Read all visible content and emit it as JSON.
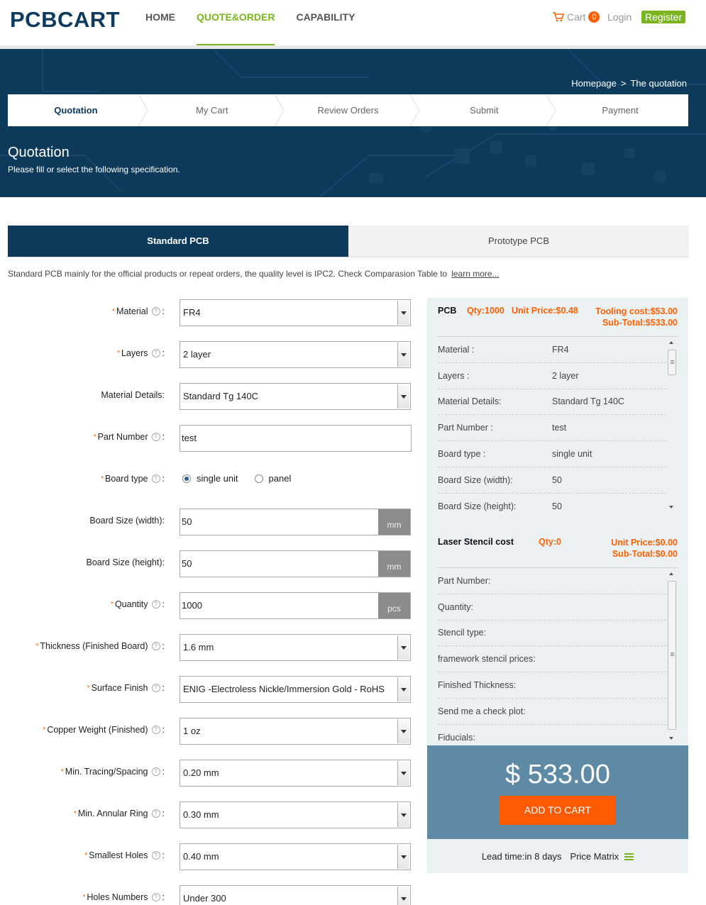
{
  "header": {
    "logo": "PCBCART",
    "nav": [
      "HOME",
      "QUOTE&ORDER",
      "CAPABILITY"
    ],
    "active_nav": "QUOTE&ORDER",
    "cart_label": "Cart",
    "cart_count": "0",
    "login": "Login",
    "register": "Register"
  },
  "banner": {
    "breadcrumb": [
      "Homepage",
      ">",
      "The quotation"
    ],
    "steps": [
      "Quotation",
      "My Cart",
      "Review Orders",
      "Submit",
      "Payment"
    ],
    "title": "Quotation",
    "subtitle": "Please fill or select the following specification."
  },
  "tabs": [
    "Standard PCB",
    "Prototype PCB"
  ],
  "description": {
    "text": "Standard PCB mainly for the official products or repeat orders, the quality level is IPC2. Check Comparasion Table to",
    "link": "learn more..."
  },
  "form": {
    "material": {
      "label": "Material",
      "value": "FR4"
    },
    "layers": {
      "label": "Layers",
      "value": "2 layer"
    },
    "material_details": {
      "label": "Material Details:",
      "value": "Standard Tg 140C"
    },
    "part_number": {
      "label": "Part Number",
      "value": "test"
    },
    "board_type": {
      "label": "Board type",
      "options": [
        "single unit",
        "panel"
      ],
      "selected": "single unit"
    },
    "board_width": {
      "label": "Board Size (width):",
      "value": "50",
      "unit": "mm"
    },
    "board_height": {
      "label": "Board Size (height):",
      "value": "50",
      "unit": "mm"
    },
    "quantity": {
      "label": "Quantity",
      "value": "1000",
      "unit": "pcs"
    },
    "thickness": {
      "label": "Thickness (Finished Board)",
      "value": "1.6 mm"
    },
    "surface_finish": {
      "label": "Surface Finish",
      "value": "ENIG -Electroless Nickle/Immersion Gold - RoHS"
    },
    "copper_weight": {
      "label": "Copper Weight (Finished)",
      "value": "1 oz"
    },
    "min_tracing": {
      "label": "Min. Tracing/Spacing",
      "value": "0.20 mm"
    },
    "min_annular": {
      "label": "Min. Annular Ring",
      "value": "0.30 mm"
    },
    "smallest_holes": {
      "label": "Smallest Holes",
      "value": "0.40 mm"
    },
    "holes_numbers": {
      "label": "Holes Numbers",
      "value": "Under 300"
    }
  },
  "summary": {
    "pcb": {
      "name": "PCB",
      "qty": "Qty:1000",
      "unit_price": "Unit Price:$0.48",
      "tooling": "Tooling cost:$53.00",
      "subtotal": "Sub-Total:$533.00",
      "rows": [
        {
          "k": "Material :",
          "v": "FR4"
        },
        {
          "k": "Layers :",
          "v": "2 layer"
        },
        {
          "k": "Material Details:",
          "v": "Standard Tg 140C"
        },
        {
          "k": "Part Number :",
          "v": "test"
        },
        {
          "k": "Board type :",
          "v": "single unit"
        },
        {
          "k": "Board Size (width):",
          "v": "50"
        },
        {
          "k": "Board Size (height):",
          "v": "50"
        }
      ]
    },
    "stencil": {
      "name": "Laser Stencil cost",
      "qty": "Qty:0",
      "unit_price": "Unit Price:$0.00",
      "subtotal": "Sub-Total:$0.00",
      "rows": [
        {
          "k": "Part Number:",
          "v": ""
        },
        {
          "k": "Quantity:",
          "v": ""
        },
        {
          "k": "Stencil type:",
          "v": ""
        },
        {
          "k": "framework stencil prices:",
          "v": ""
        },
        {
          "k": "Finished Thickness:",
          "v": ""
        },
        {
          "k": "Send me a check plot:",
          "v": ""
        },
        {
          "k": "Fiducials:",
          "v": ""
        }
      ]
    },
    "total": "$ 533.00",
    "add_to_cart": "ADD TO CART",
    "lead_time": "Lead time:in 8 days",
    "price_matrix": "Price Matrix"
  }
}
